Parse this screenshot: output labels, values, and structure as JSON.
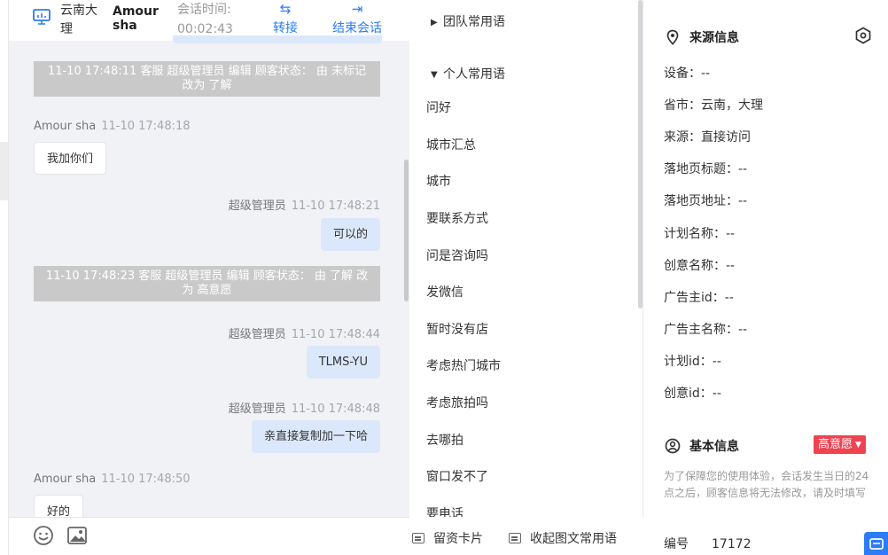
{
  "chat": {
    "header": {
      "region": "云南大理",
      "visitor_name": "Amour sha",
      "session_time_label": "会话时间:",
      "session_time": "00:02:43",
      "transfer_label": "转接",
      "end_label": "结束会话"
    },
    "messages": [
      {
        "kind": "system",
        "text": "11-10 17:48:11 客服 超级管理员 编辑 顾客状态： 由 未标记 改为 了解"
      },
      {
        "kind": "visitor",
        "sender": "Amour sha",
        "time": "11-10 17:48:18",
        "text": "我加你们"
      },
      {
        "kind": "agent",
        "sender": "超级管理员",
        "time": "11-10 17:48:21",
        "text": "可以的"
      },
      {
        "kind": "system",
        "text": "11-10 17:48:23 客服 超级管理员 编辑 顾客状态： 由 了解 改为 高意愿"
      },
      {
        "kind": "agent",
        "sender": "超级管理员",
        "time": "11-10 17:48:44",
        "text": "TLMS-YU"
      },
      {
        "kind": "agent",
        "sender": "超级管理员",
        "time": "11-10 17:48:48",
        "text": "亲直接复制加一下哈"
      },
      {
        "kind": "visitor",
        "sender": "Amour sha",
        "time": "11-10 17:48:50",
        "text": "好的"
      }
    ]
  },
  "phrases": {
    "team_group": "团队常用语",
    "personal_group": "个人常用语",
    "items": [
      "问好",
      "城市汇总",
      "城市",
      "要联系方式",
      "问是咨询吗",
      "发微信",
      "暂时没有店",
      "考虑热门城市",
      "考虑旅拍吗",
      "去哪拍",
      "窗口发不了",
      "要电话"
    ],
    "footer": {
      "card_label": "留资卡片",
      "collapse_label": "收起图文常用语"
    }
  },
  "info": {
    "source_title": "来源信息",
    "fields": [
      "设备：--",
      "省市：云南，大理",
      "来源：直接访问",
      "落地页标题：--",
      "落地页地址：--",
      "计划名称：--",
      "创意名称：--",
      "广告主id：--",
      "广告主名称：--",
      "计划id：--",
      "创意id：--"
    ],
    "basic_title": "基本信息",
    "intent_badge": "高意愿",
    "note": "为了保障您的使用体验，会话发生当日的24点之后，顾客信息将无法修改，请及时填写",
    "id_label": "编号",
    "id_value": "17172"
  },
  "colors": {
    "accent": "#2b7cf6",
    "badge": "#ef4350",
    "agent_bubble": "#dbe8fb"
  }
}
